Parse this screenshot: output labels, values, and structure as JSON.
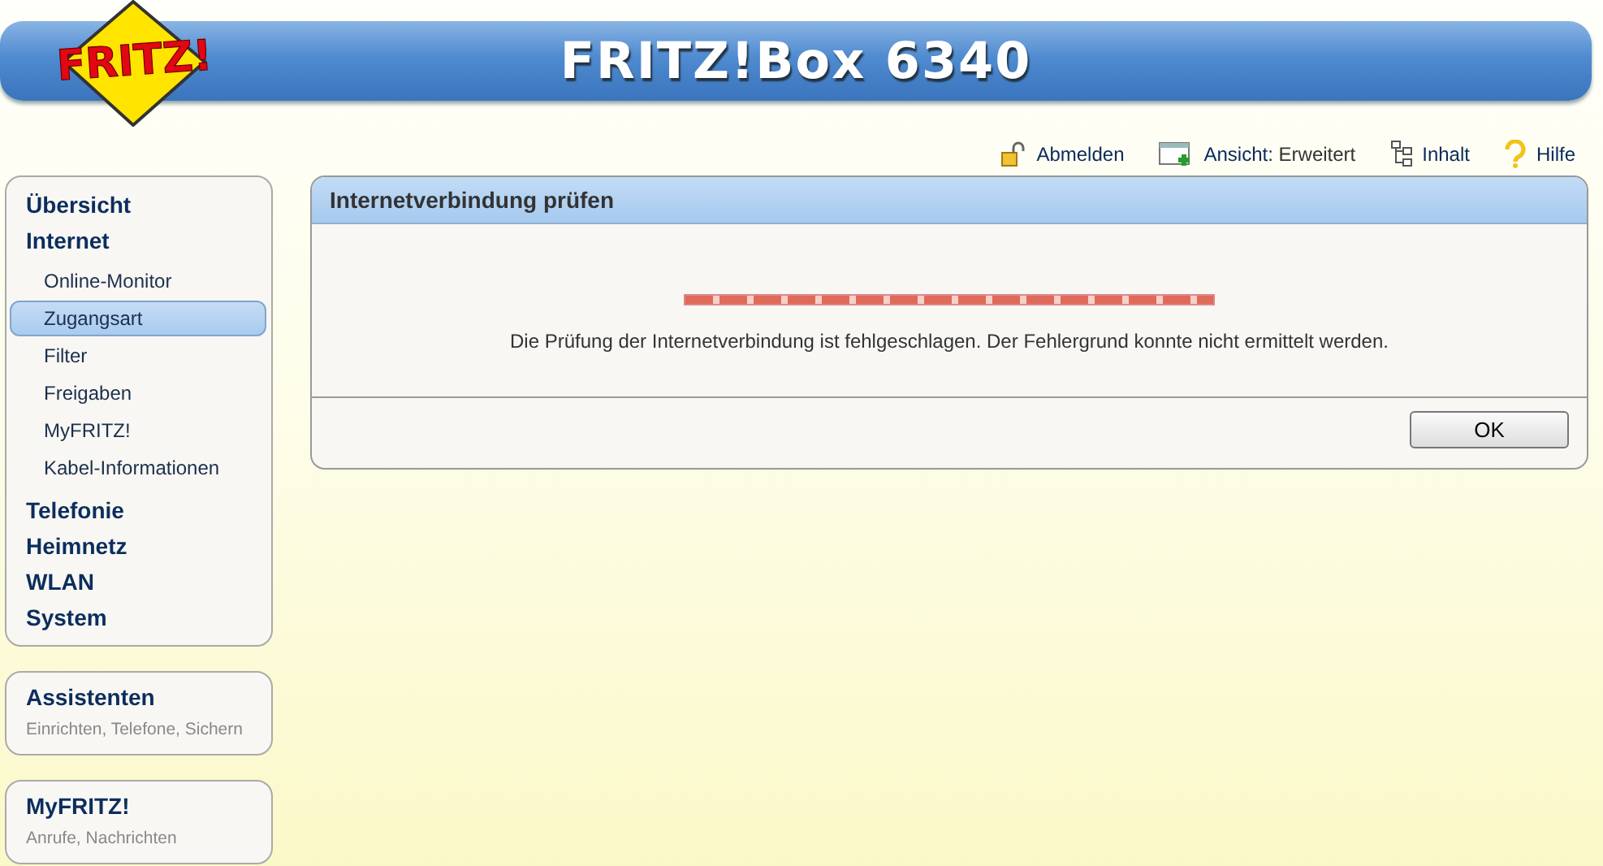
{
  "header": {
    "logo": "FRITZ!",
    "title": "FRITZ!Box 6340"
  },
  "toolbar": [
    {
      "kind": "logout",
      "label": "Abmelden"
    },
    {
      "kind": "view",
      "label": "Ansicht:",
      "value": "Erweitert"
    },
    {
      "kind": "content",
      "label": "Inhalt"
    },
    {
      "kind": "help",
      "label": "Hilfe"
    }
  ],
  "sidebar": {
    "items": [
      {
        "label": "Übersicht",
        "selected": false
      },
      {
        "label": "Internet",
        "selected": false,
        "children": [
          {
            "label": "Online-Monitor",
            "selected": false
          },
          {
            "label": "Zugangsart",
            "selected": true
          },
          {
            "label": "Filter",
            "selected": false
          },
          {
            "label": "Freigaben",
            "selected": false
          },
          {
            "label": "MyFRITZ!",
            "selected": false
          },
          {
            "label": "Kabel-Informationen",
            "selected": false
          }
        ]
      },
      {
        "label": "Telefonie",
        "selected": false
      },
      {
        "label": "Heimnetz",
        "selected": false
      },
      {
        "label": "WLAN",
        "selected": false
      },
      {
        "label": "System",
        "selected": false
      }
    ]
  },
  "boxes": [
    {
      "title": "Assistenten",
      "subtitle": "Einrichten, Telefone, Sichern"
    },
    {
      "title": "MyFRITZ!",
      "subtitle": "Anrufe, Nachrichten"
    }
  ],
  "panel": {
    "title": "Internetverbindung prüfen",
    "progress": {
      "level": 1,
      "failed": true
    },
    "message": "Die Prüfung der Internetverbindung ist fehlgeschlagen. Der Fehlergrund konnte nicht ermittelt werden.",
    "buttons": [
      "OK"
    ]
  }
}
